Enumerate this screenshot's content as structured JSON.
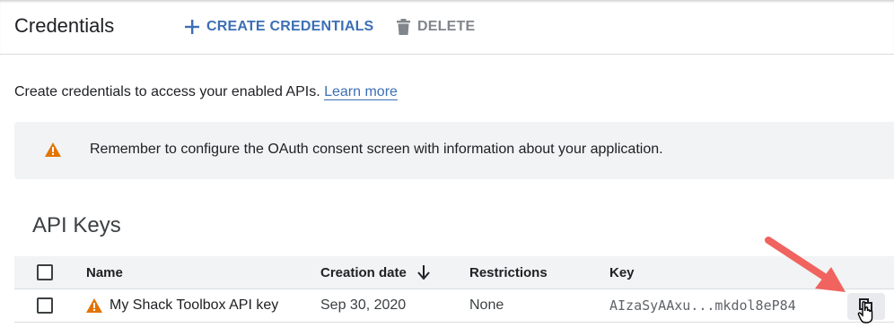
{
  "header": {
    "title": "Credentials",
    "create_label": "CREATE CREDENTIALS",
    "delete_label": "DELETE"
  },
  "intro": {
    "text": "Create credentials to access your enabled APIs.",
    "link": "Learn more"
  },
  "banner": {
    "message": "Remember to configure the OAuth consent screen with information about your application."
  },
  "api_keys": {
    "title": "API Keys",
    "columns": {
      "name": "Name",
      "creation_date": "Creation date",
      "restrictions": "Restrictions",
      "key": "Key"
    },
    "rows": [
      {
        "name": "My Shack Toolbox API key",
        "creation_date": "Sep 30, 2020",
        "restrictions": "None",
        "key": "AIzaSyAAxu...mkdol8eP84",
        "warning": true
      }
    ]
  },
  "colors": {
    "accent": "#3c6fb5",
    "warning": "#e37400",
    "arrow": "#f0635f",
    "banner_bg": "#f1f3f4"
  },
  "icons": {
    "create": "plus-icon",
    "delete": "trash-icon",
    "warning": "warning-icon",
    "sort": "arrow-down-icon",
    "copy": "copy-icon",
    "cursor": "hand-cursor-icon"
  }
}
